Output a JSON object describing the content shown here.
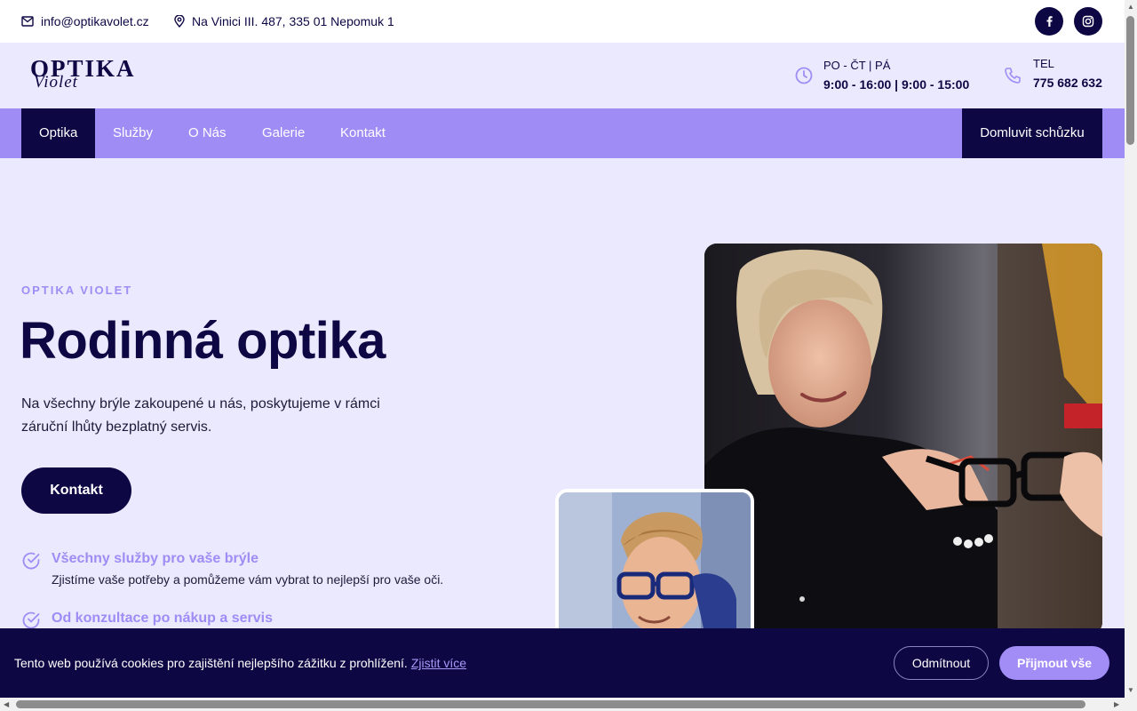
{
  "topbar": {
    "email": "info@optikavolet.cz",
    "address": "Na Vinici III. 487, 335 01 Nepomuk 1",
    "icons": [
      "mail-icon",
      "location-pin-icon",
      "facebook-icon",
      "instagram-icon"
    ]
  },
  "header": {
    "logo_word": "OPTIKA",
    "logo_script": "Violet",
    "hours_label": "PO - ČT | PÁ",
    "hours_value": "9:00 - 16:00 | 9:00 - 15:00",
    "phone_label": "TEL",
    "phone_value": "775 682 632"
  },
  "nav": {
    "items": [
      {
        "label": "Optika"
      },
      {
        "label": "Služby"
      },
      {
        "label": "O Nás"
      },
      {
        "label": "Galerie"
      },
      {
        "label": "Kontakt"
      }
    ],
    "cta": "Domluvit schůzku"
  },
  "hero": {
    "eyebrow": "OPTIKA VIOLET",
    "title": "Rodinná optika",
    "description": "Na všechny brýle zakoupené u nás, poskytujeme v rámci záruční lhůty bezplatný servis.",
    "cta": "Kontakt",
    "features": [
      {
        "title": "Všechny služby pro vaše brýle",
        "text": "Zjistíme vaše potřeby a pomůžeme vám vybrat to nejlepší pro vaše oči."
      },
      {
        "title": "Od konzultace po nákup a servis",
        "text": ""
      }
    ]
  },
  "cookie": {
    "text": "Tento web používá cookies pro zajištění nejlepšího zážitku z prohlížení.",
    "link": "Zjistit více",
    "decline": "Odmítnout",
    "accept": "Přijmout vše"
  },
  "colors": {
    "primary": "#0d0744",
    "accent": "#9f8cf5",
    "background": "#eae9fd"
  }
}
